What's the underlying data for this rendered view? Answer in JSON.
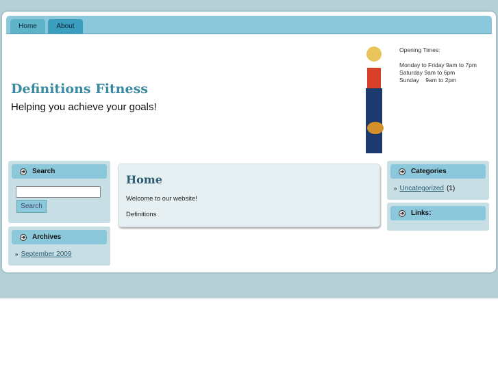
{
  "nav": {
    "tabs": [
      "Home",
      "About"
    ]
  },
  "header": {
    "title": "Definitions Fitness",
    "tagline": "Helping you achieve your goals!",
    "hours_title": "Opening Times:",
    "hours": [
      "Monday to Friday 9am to 7pm",
      "Saturday 9am to 6pm",
      "Sunday    9am to 2pm"
    ]
  },
  "left": {
    "search_title": "Search",
    "search_button": "Search",
    "search_value": "",
    "archives_title": "Archives",
    "archives": [
      "September 2009"
    ]
  },
  "main": {
    "title": "Home",
    "paragraphs": [
      "Welcome to our website!",
      "Definitions"
    ]
  },
  "right": {
    "categories_title": "Categories",
    "categories": [
      {
        "name": "Uncategorized",
        "count": "(1)"
      }
    ],
    "links_title": "Links:"
  }
}
